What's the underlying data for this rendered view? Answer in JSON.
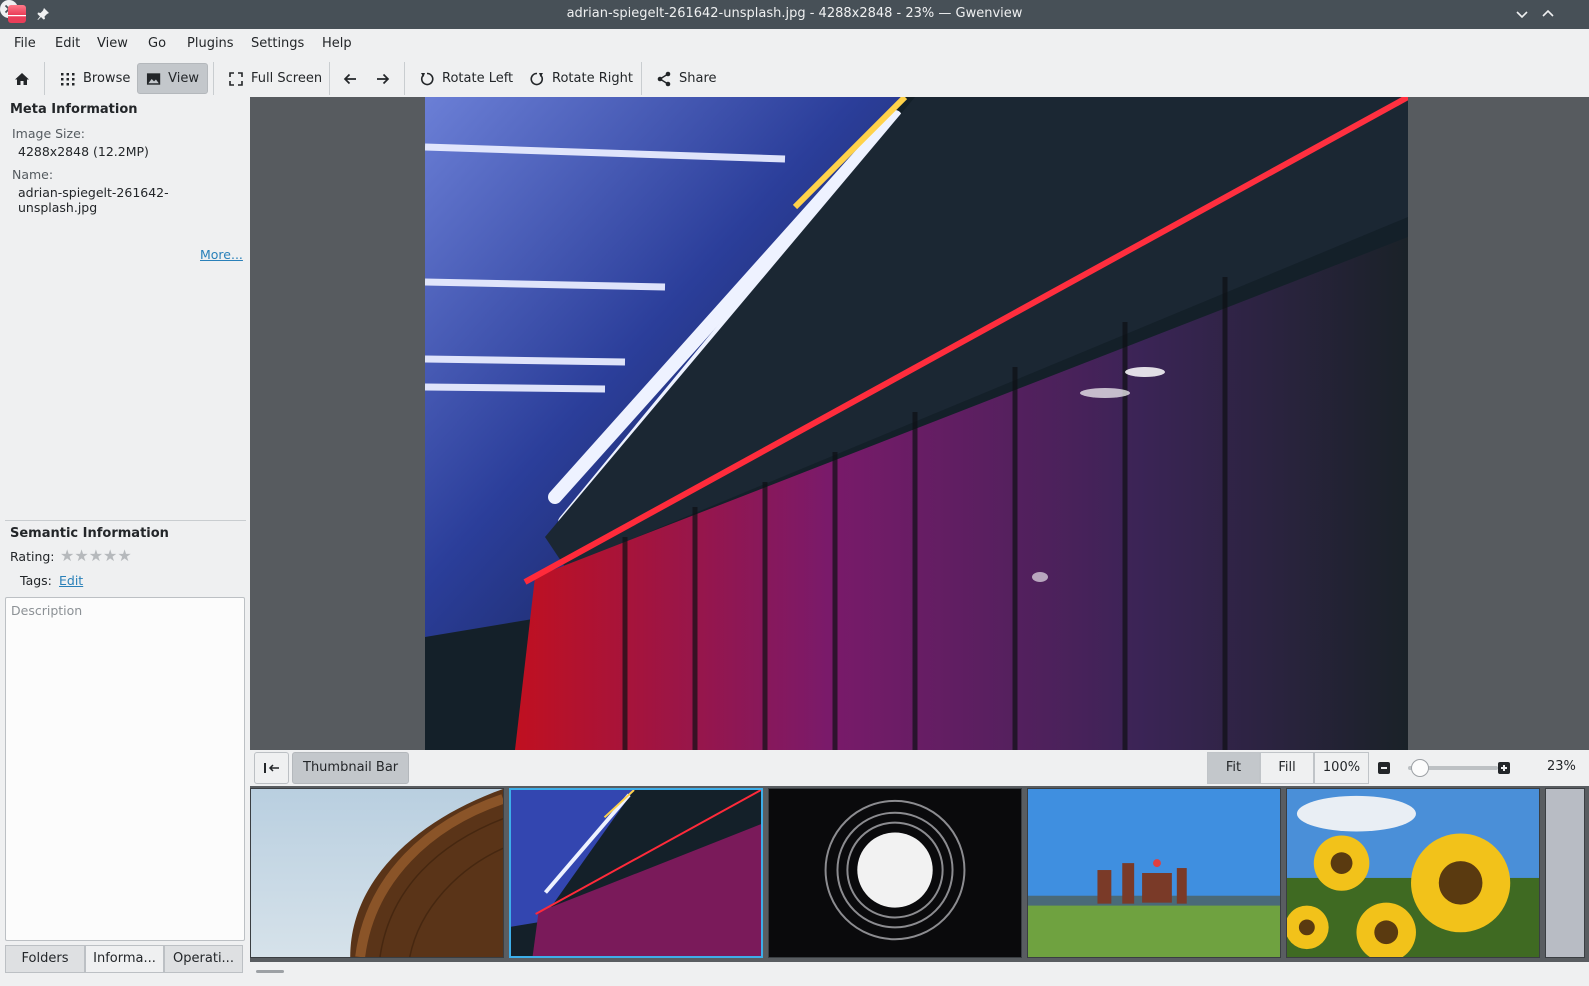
{
  "window": {
    "title": "adrian-spiegelt-261642-unsplash.jpg - 4288x2848 - 23% — Gwenview"
  },
  "menu": [
    "File",
    "Edit",
    "View",
    "Go",
    "Plugins",
    "Settings",
    "Help"
  ],
  "toolbar": {
    "browse": "Browse",
    "view": "View",
    "full_screen": "Full Screen",
    "rotate_left": "Rotate Left",
    "rotate_right": "Rotate Right",
    "share": "Share"
  },
  "sidebar": {
    "meta_heading": "Meta Information",
    "image_size_label": "Image Size:",
    "image_size_value": "4288x2848 (12.2MP)",
    "name_label": "Name:",
    "name_value": "adrian-spiegelt-261642-unsplash.jpg",
    "more_link": "More...",
    "semantic_heading": "Semantic Information",
    "rating_label": "Rating:",
    "rating_value": 0,
    "rating_max": 5,
    "tags_label": "Tags:",
    "tags_edit": "Edit",
    "description_placeholder": "Description",
    "tabs": [
      "Folders",
      "Informa...",
      "Operati..."
    ],
    "active_tab": 1
  },
  "statusbar": {
    "thumbnail_bar": "Thumbnail Bar",
    "fit": "Fit",
    "fill": "Fill",
    "hundred": "100%",
    "zoom": "23%",
    "zoom_level": 0.23
  },
  "thumbnails": [
    {
      "name": "stadium-roof",
      "selected": false
    },
    {
      "name": "neon-corridor",
      "selected": true
    },
    {
      "name": "light-spiral",
      "selected": false
    },
    {
      "name": "gas-works-park",
      "selected": false
    },
    {
      "name": "sunflowers",
      "selected": false
    }
  ]
}
